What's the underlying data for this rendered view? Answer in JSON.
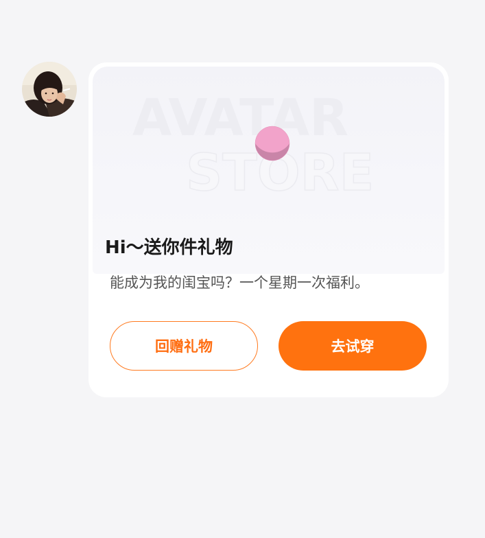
{
  "sender": {
    "avatar_icon": "user-photo-avatar"
  },
  "card": {
    "banner": {
      "watermark_line1": "AVATAR",
      "watermark_line2": "STORE",
      "ball_color": "#f0a0c8"
    },
    "title": "Hi～送你件礼物",
    "description": "能成为我的闺宝吗？一个星期一次福利。",
    "buttons": {
      "return_gift": "回赠礼物",
      "try_on": "去试穿"
    },
    "accent_color": "#ff720f"
  }
}
